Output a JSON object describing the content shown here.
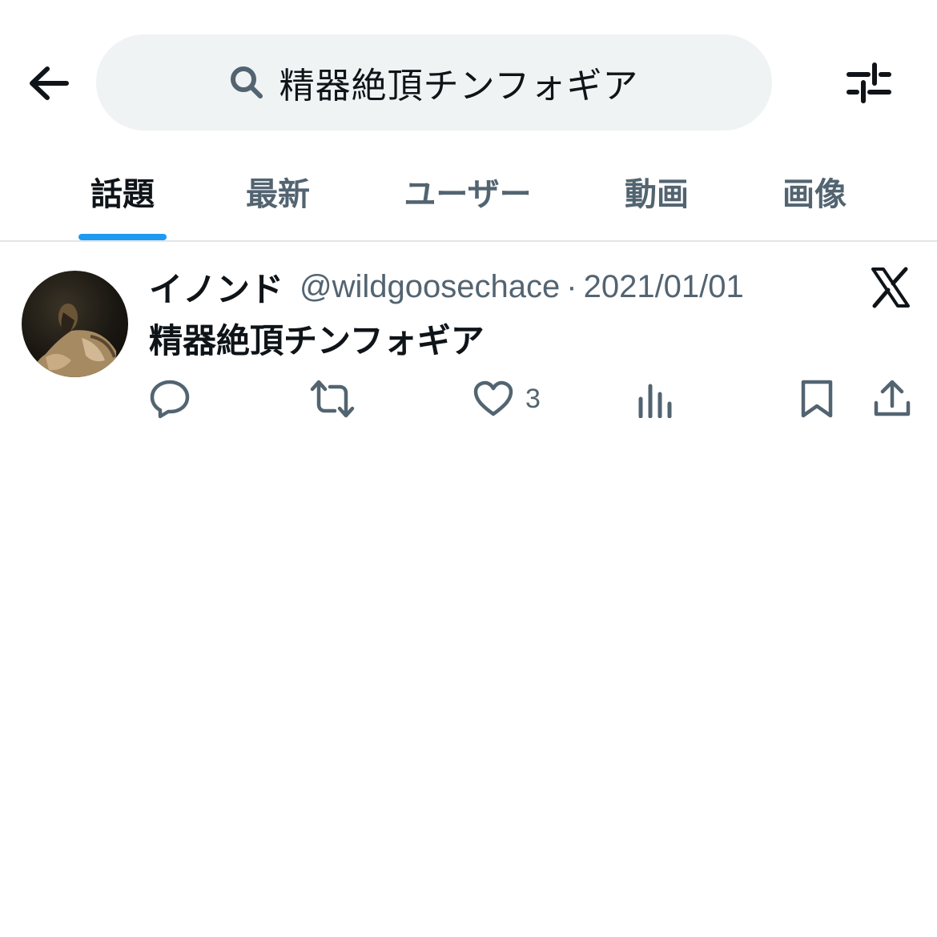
{
  "search": {
    "query": "精器絶頂チンフォギア"
  },
  "tabs": [
    {
      "label": "話題",
      "active": true
    },
    {
      "label": "最新",
      "active": false
    },
    {
      "label": "ユーザー",
      "active": false
    },
    {
      "label": "動画",
      "active": false
    },
    {
      "label": "画像",
      "active": false
    }
  ],
  "tweet": {
    "display_name": "イノンド",
    "handle": "@wildgoosechace",
    "separator": "·",
    "date": "2021/01/01",
    "text": "精器絶頂チンフォギア",
    "likes": "3"
  },
  "icons": {
    "back": "arrow-left-icon",
    "search": "search-icon",
    "filter": "filter-sliders-icon",
    "source": "x-logo-icon",
    "reply": "reply-icon",
    "retweet": "retweet-icon",
    "like": "heart-icon",
    "views": "views-icon",
    "bookmark": "bookmark-icon",
    "share": "share-icon"
  },
  "colors": {
    "accent": "#1d9bf0",
    "text_primary": "#0f1419",
    "text_secondary": "#536471",
    "search_bg": "#eff3f4"
  }
}
